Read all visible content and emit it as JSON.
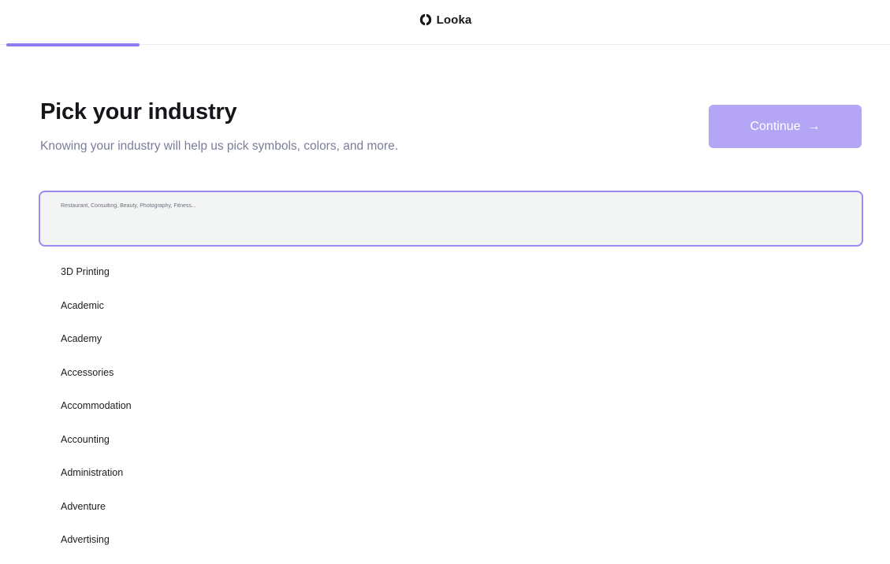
{
  "header": {
    "brand_name": "Looka",
    "progress": 0.15
  },
  "main": {
    "title": "Pick your industry",
    "subtitle": "Knowing your industry will help us pick symbols, colors, and more.",
    "continue_label": "Continue",
    "continue_icon": "arrow-right-icon"
  },
  "search": {
    "placeholder": "Restaurant, Consulting, Beauty, Photography, Fitness...",
    "value": ""
  },
  "industries": [
    "3D Printing",
    "Academic",
    "Academy",
    "Accessories",
    "Accommodation",
    "Accounting",
    "Administration",
    "Adventure",
    "Advertising"
  ],
  "colors": {
    "accent": "#8f7cf2",
    "button": "#b4a6f5",
    "input_border": "#9a8bf2",
    "input_bg": "#f3f4f4",
    "subtitle": "#7a7d99"
  }
}
